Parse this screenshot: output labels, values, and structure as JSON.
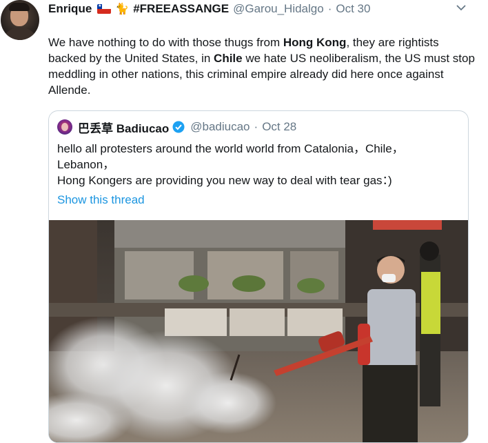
{
  "tweet": {
    "display_name": "Enrique",
    "flag": "Chile flag",
    "emoji_icon": "cat-emoji",
    "hashtag": "#FREEASSANGE",
    "handle": "@Garou_Hidalgo",
    "separator": "·",
    "date": "Oct 30",
    "text_segments": [
      "We have nothing to do with those thugs from ",
      "Hong Kong",
      ", they are rightists backed by the United States, in ",
      "Chile",
      " we hate US neoliberalism, the US must stop meddling in other nations, this criminal empire already did here once against Allende."
    ]
  },
  "quoted_tweet": {
    "display_name": "巴丢草 Badiucao",
    "handle": "@badiucao",
    "separator": "·",
    "date": "Oct 28",
    "lines": [
      "hello all protesters around the world world from Catalonia，Chile，",
      "Lebanon，",
      "Hong Kongers are providing you new way to deal with tear gas：)"
    ],
    "show_thread": "Show this thread",
    "media_icon": "video-thumbnail"
  },
  "colors": {
    "text": "#14171a",
    "secondary": "#657786",
    "link": "#1b95e0",
    "border": "#ccd6dd",
    "verified": "#1da1f2"
  }
}
